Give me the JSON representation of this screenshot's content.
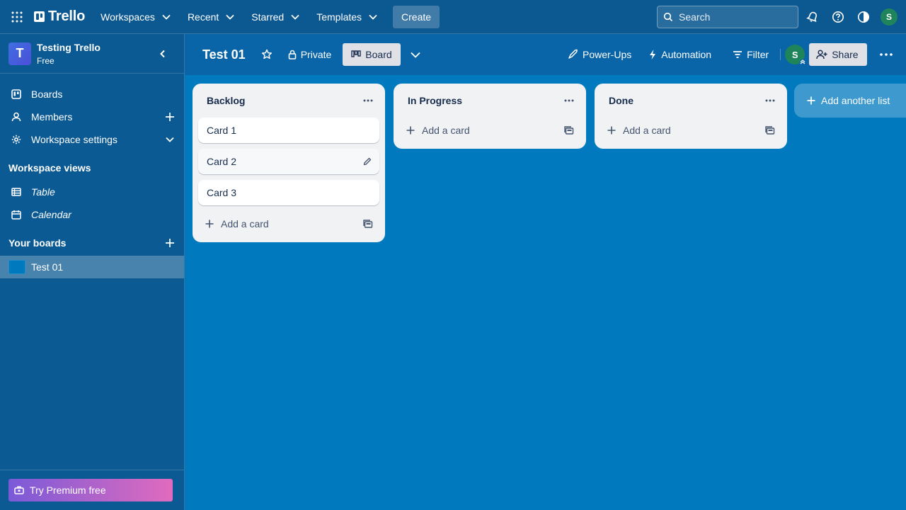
{
  "topbar": {
    "logo": "Trello",
    "menus": [
      "Workspaces",
      "Recent",
      "Starred",
      "Templates"
    ],
    "create": "Create",
    "search_placeholder": "Search",
    "avatar": "S"
  },
  "sidebar": {
    "workspace_letter": "T",
    "workspace_name": "Testing Trello",
    "workspace_plan": "Free",
    "items": [
      {
        "label": "Boards",
        "icon": "trello-board-icon"
      },
      {
        "label": "Members",
        "icon": "person-icon"
      },
      {
        "label": "Workspace settings",
        "icon": "gear-icon"
      }
    ],
    "views_heading": "Workspace views",
    "views": [
      {
        "label": "Table",
        "icon": "table-icon"
      },
      {
        "label": "Calendar",
        "icon": "calendar-icon"
      }
    ],
    "boards_heading": "Your boards",
    "boards": [
      {
        "label": "Test 01",
        "color": "#0079bf"
      }
    ],
    "premium": "Try Premium free"
  },
  "board": {
    "title": "Test 01",
    "visibility": "Private",
    "view": "Board",
    "powerups": "Power-Ups",
    "automation": "Automation",
    "filter": "Filter",
    "member_avatar": "S",
    "share": "Share"
  },
  "lists": [
    {
      "title": "Backlog",
      "cards": [
        "Card 1",
        "Card 2",
        "Card 3"
      ],
      "add_label": "Add a card"
    },
    {
      "title": "In Progress",
      "cards": [],
      "add_label": "Add a card"
    },
    {
      "title": "Done",
      "cards": [],
      "add_label": "Add a card"
    }
  ],
  "add_list": "Add another list",
  "colors": {
    "board_bg": "#0079bf",
    "topbar": "#0c5891",
    "avatar": "#1f845a"
  }
}
